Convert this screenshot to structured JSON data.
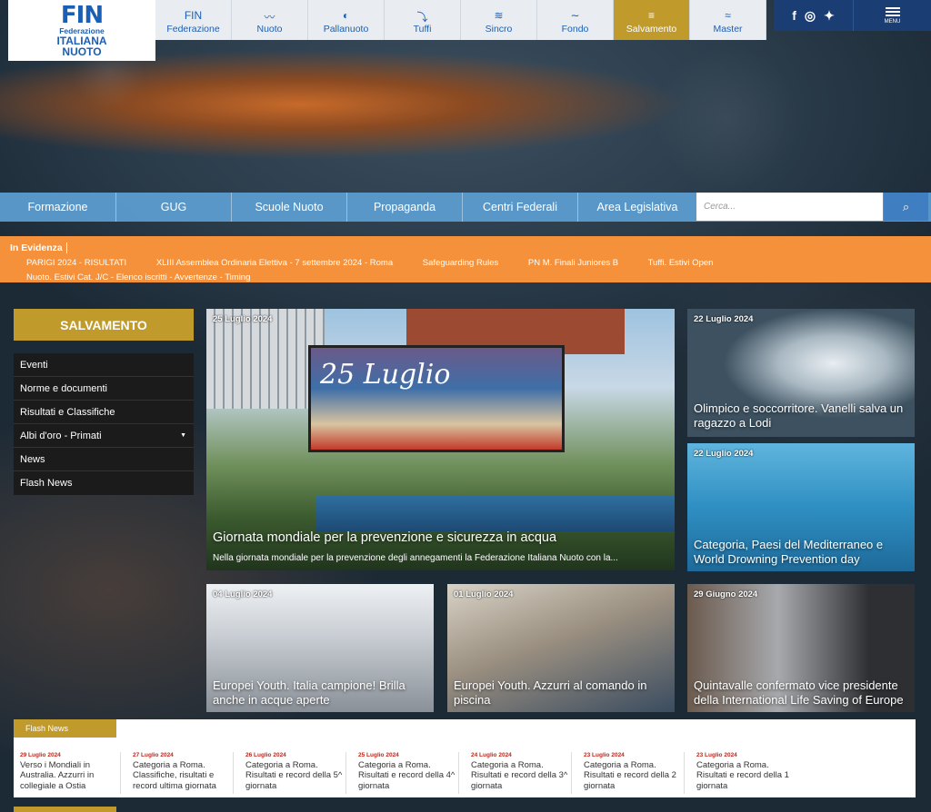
{
  "topnav": {
    "items": [
      {
        "label": "Federazione",
        "icon": "fin-icon"
      },
      {
        "label": "Nuoto",
        "icon": "nuoto-icon"
      },
      {
        "label": "Pallanuoto",
        "icon": "pallanuoto-icon"
      },
      {
        "label": "Tuffi",
        "icon": "tuffi-icon"
      },
      {
        "label": "Sincro",
        "icon": "sincro-icon"
      },
      {
        "label": "Fondo",
        "icon": "fondo-icon"
      },
      {
        "label": "Salvamento",
        "icon": "salvamento-icon",
        "active": true
      },
      {
        "label": "Master",
        "icon": "master-icon"
      }
    ],
    "menu_label": "MENU"
  },
  "logo": {
    "line1": "FIN",
    "line2": "Federazione",
    "line3": "ITALIANA",
    "line4": "NUOTO"
  },
  "subnav": {
    "items": [
      "Formazione",
      "GUG",
      "Scuole Nuoto",
      "Propaganda",
      "Centri Federali",
      "Area Legislativa"
    ],
    "search_placeholder": "Cerca..."
  },
  "evidenza": {
    "heading": "In Evidenza",
    "items": [
      "PARIGI 2024 - RISULTATI",
      "XLIII Assemblea Ordinaria Elettiva - 7 settembre 2024 - Roma",
      "Safeguarding Rules",
      "PN M. Finali Juniores B",
      "Tuffi. Estivi Open"
    ],
    "item_row2": "Nuoto. Estivi Cat. J/C - Elenco iscritti - Avvertenze - Timing"
  },
  "sidebar": {
    "title": "SALVAMENTO",
    "items": [
      "Eventi",
      "Norme e documenti",
      "Risultati e Classifiche",
      "Albi d'oro - Primati",
      "News",
      "Flash News"
    ]
  },
  "cards": {
    "main": {
      "date": "25 Luglio 2024",
      "title": "Giornata mondiale per la prevenzione e sicurezza in acqua",
      "desc": "Nella giornata mondiale per la prevenzione degli annegamenti la Federazione Italiana Nuoto con la..."
    },
    "right1": {
      "date": "22 Luglio 2024",
      "title": "Olimpico e soccorritore. Vanelli salva un ragazzo a Lodi"
    },
    "right2": {
      "date": "22 Luglio 2024",
      "title": "Categoria, Paesi del Mediterraneo e World Drowning Prevention day"
    },
    "bottom1": {
      "date": "04 Luglio 2024",
      "title": "Europei Youth. Italia campione! Brilla anche in acque aperte"
    },
    "bottom2": {
      "date": "01 Luglio 2024",
      "title": "Europei Youth. Azzurri al comando in piscina"
    },
    "bottom3": {
      "date": "29 Giugno 2024",
      "title": "Quintavalle confermato vice presidente della International Life Saving of Europe"
    },
    "banner_text": "25 Luglio"
  },
  "flash": {
    "title": "Flash News",
    "items": [
      {
        "date": "29 Luglio 2024",
        "text": "Verso i Mondiali in Australia. Azzurri in collegiale a Ostia"
      },
      {
        "date": "27 Luglio 2024",
        "text": "Categoria a Roma. Classifiche, risultati e record ultima giornata"
      },
      {
        "date": "26 Luglio 2024",
        "text": "Categoria a Roma. Risultati e record della 5^ giornata"
      },
      {
        "date": "25 Luglio 2024",
        "text": "Categoria a Roma. Risultati e record della 4^ giornata"
      },
      {
        "date": "24 Luglio 2024",
        "text": "Categoria a Roma. Risultati e record della 3^ giornata"
      },
      {
        "date": "23 Luglio 2024",
        "text": "Categoria a Roma. Risultati e record della 2 giornata"
      },
      {
        "date": "23 Luglio 2024",
        "text": "Categoria a Roma. Risultati e record della 1 giornata"
      }
    ]
  },
  "colors": {
    "gold": "#c09a2b",
    "navy": "#1a3e73",
    "orange": "#f5913a",
    "blue": "#5b9ccf"
  }
}
